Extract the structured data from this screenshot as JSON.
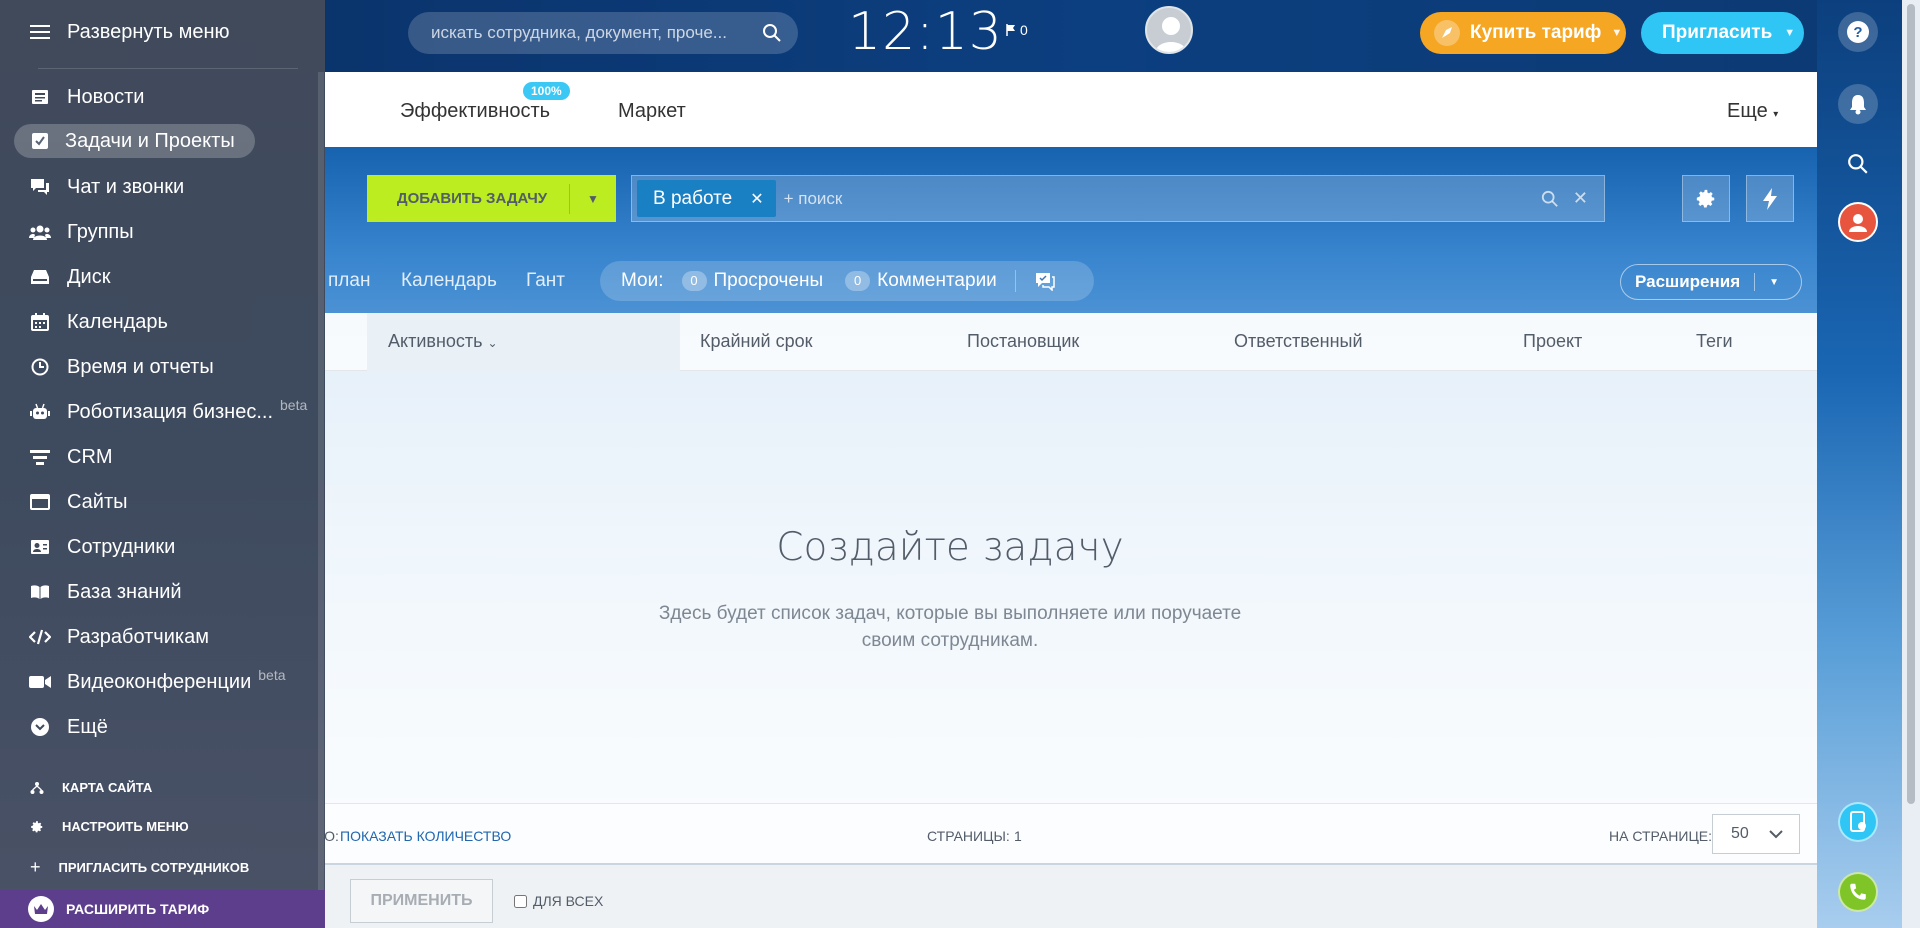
{
  "header": {
    "search_placeholder": "искать сотрудника, документ, проче...",
    "clock": "12:13",
    "flag_count": "0",
    "buy_label": "Купить тариф",
    "invite_label": "Пригласить"
  },
  "tabs": {
    "efficiency": "Эффективность",
    "efficiency_badge": "100%",
    "market": "Маркет",
    "more": "Еще"
  },
  "toolbar": {
    "add_task": "ДОБАВИТЬ ЗАДАЧУ",
    "filter_chip": "В работе",
    "filter_placeholder": "+ поиск"
  },
  "views": {
    "plan_fragment": "план",
    "calendar": "Календарь",
    "gantt": "Гант",
    "mine_label": "Мои:",
    "overdue_count": "0",
    "overdue_label": "Просрочены",
    "comments_count": "0",
    "comments_label": "Комментарии",
    "extensions": "Расширения"
  },
  "grid": {
    "columns": [
      "Активность",
      "Крайний срок",
      "Постановщик",
      "Ответственный",
      "Проект",
      "Теги"
    ],
    "empty_title": "Создайте задачу",
    "empty_text": "Здесь будет список задач, которые вы выполняете или поручаете своим сотрудникам.",
    "total_label": "ВСЕГО:",
    "show_count": "ПОКАЗАТЬ КОЛИЧЕСТВО",
    "pages_label": "СТРАНИЦЫ:",
    "pages_value": "1",
    "per_page_label": "НА СТРАНИЦЕ:",
    "per_page_value": "50",
    "apply": "ПРИМЕНИТЬ",
    "for_all": "ДЛЯ ВСЕХ"
  },
  "menu": {
    "toggle": "Развернуть меню",
    "items": [
      {
        "label": "Новости",
        "icon": "news-icon"
      },
      {
        "label": "Задачи и Проекты",
        "icon": "tasks-icon",
        "active": true
      },
      {
        "label": "Чат и звонки",
        "icon": "chat-icon"
      },
      {
        "label": "Группы",
        "icon": "groups-icon"
      },
      {
        "label": "Диск",
        "icon": "disk-icon"
      },
      {
        "label": "Календарь",
        "icon": "calendar-icon"
      },
      {
        "label": "Время и отчеты",
        "icon": "clock-icon"
      },
      {
        "label": "Роботизация бизнес...",
        "icon": "robot-icon",
        "beta": "beta"
      },
      {
        "label": "CRM",
        "icon": "crm-icon"
      },
      {
        "label": "Сайты",
        "icon": "sites-icon"
      },
      {
        "label": "Сотрудники",
        "icon": "employees-icon"
      },
      {
        "label": "База знаний",
        "icon": "knowledge-icon"
      },
      {
        "label": "Разработчикам",
        "icon": "code-icon"
      },
      {
        "label": "Видеоконференции",
        "icon": "video-icon",
        "beta": "beta"
      },
      {
        "label": "Ещё",
        "icon": "more-icon"
      }
    ],
    "sitemap": "КАРТА САЙТА",
    "configure": "НАСТРОИТЬ МЕНЮ",
    "invite": "ПРИГЛАСИТЬ СОТРУДНИКОВ",
    "upgrade": "РАСШИРИТЬ ТАРИФ"
  },
  "colors": {
    "accent_green": "#bbed21",
    "accent_orange": "#f5a623",
    "accent_cyan": "#2fc6f6"
  }
}
